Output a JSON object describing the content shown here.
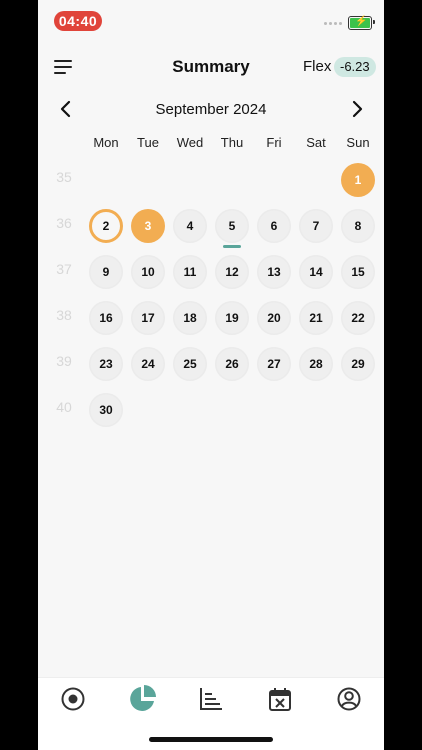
{
  "status": {
    "time": "04:40"
  },
  "header": {
    "title": "Summary",
    "flex_label": "Flex",
    "flex_value": "-6.23"
  },
  "calendar": {
    "month_label": "September 2024",
    "weekdays": [
      "Mon",
      "Tue",
      "Wed",
      "Thu",
      "Fri",
      "Sat",
      "Sun"
    ],
    "weeks": [
      {
        "number": "35",
        "days": [
          "",
          "",
          "",
          "",
          "",
          "",
          "1"
        ]
      },
      {
        "number": "36",
        "days": [
          "2",
          "3",
          "4",
          "5",
          "6",
          "7",
          "8"
        ]
      },
      {
        "number": "37",
        "days": [
          "9",
          "10",
          "11",
          "12",
          "13",
          "14",
          "15"
        ]
      },
      {
        "number": "38",
        "days": [
          "16",
          "17",
          "18",
          "19",
          "20",
          "21",
          "22"
        ]
      },
      {
        "number": "39",
        "days": [
          "23",
          "24",
          "25",
          "26",
          "27",
          "28",
          "29"
        ]
      },
      {
        "number": "40",
        "days": [
          "30",
          "",
          "",
          "",
          "",
          "",
          ""
        ]
      }
    ],
    "highlighted_days": [
      "1",
      "3"
    ],
    "today": "2",
    "underlined_day": "5"
  },
  "colors": {
    "accent": "#f2ad52",
    "teal": "#5aa59a",
    "flex_badge": "#cfe8e2"
  },
  "tabbar": {
    "items": [
      {
        "name": "tab-record",
        "icon": "record-icon"
      },
      {
        "name": "tab-summary",
        "icon": "pie-chart-icon"
      },
      {
        "name": "tab-stats",
        "icon": "bar-chart-icon"
      },
      {
        "name": "tab-calendar",
        "icon": "calendar-x-icon"
      },
      {
        "name": "tab-profile",
        "icon": "user-icon"
      }
    ]
  }
}
